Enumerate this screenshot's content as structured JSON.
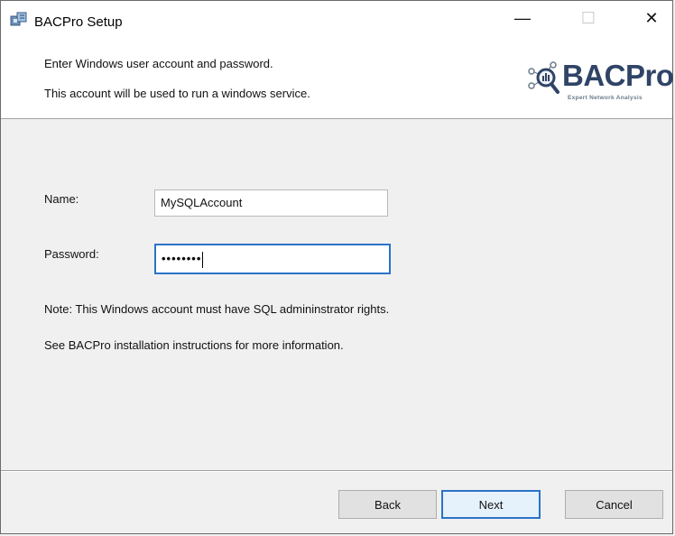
{
  "window": {
    "title": "BACPro Setup",
    "minimize_glyph": "—",
    "maximize_glyph": "☐",
    "close_glyph": "✕"
  },
  "header": {
    "line1": "Enter Windows user account and password.",
    "line2": "This account will be used to run a windows service.",
    "logo_word": "BACPro",
    "logo_tagline": "Expert Network Analysis"
  },
  "form": {
    "name_label": "Name:",
    "name_value": "MySQLAccount",
    "password_label": "Password:",
    "password_masked": "••••••••"
  },
  "notes": {
    "note1": "Note: This Windows account must have SQL admininstrator rights.",
    "note2": "See BACPro installation instructions for more information."
  },
  "buttons": {
    "back": "Back",
    "next": "Next",
    "cancel": "Cancel"
  },
  "colors": {
    "focus_border": "#2a73c8",
    "logo_text": "#2f4466",
    "dialog_bg": "#f0f0f0"
  },
  "icons": {
    "app": "installer-package-icon",
    "logo": "magnifier-network-icon"
  }
}
